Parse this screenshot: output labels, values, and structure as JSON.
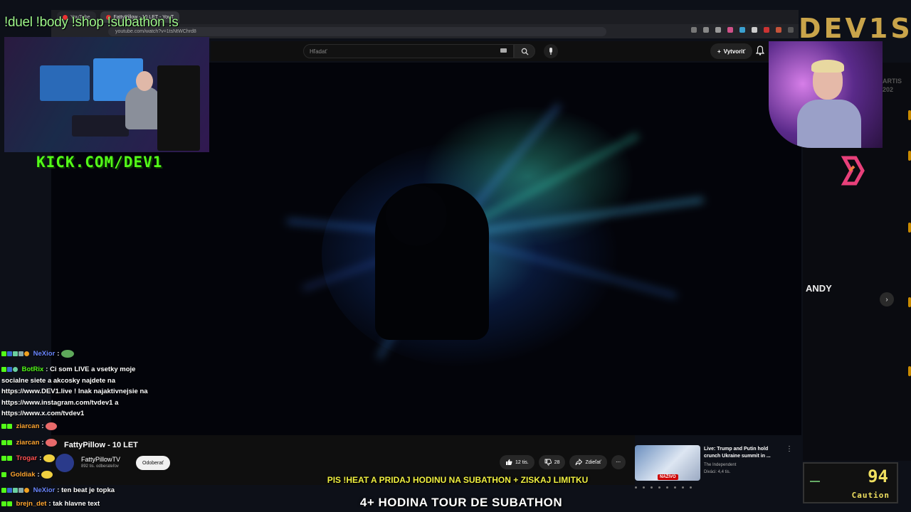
{
  "browser": {
    "tabs": [
      {
        "label": "YouTube",
        "active": false
      },
      {
        "label": "FattyPillow - 10 LET - YouT",
        "active": true
      }
    ],
    "url": "youtube.com/watch?v=1tsNtWChrd8"
  },
  "youtube": {
    "search_placeholder": "Hľadať",
    "create_label": "Vytvoriť",
    "video_title": "FattyPillow - 10 LET",
    "channel_name": "FattyPillowTV",
    "subscribers": "892 tis. odberateľov",
    "subscribe_label": "Odoberať",
    "likes": "12 tis.",
    "dislikes": "28",
    "share_label": "Zdieľať",
    "recommended": {
      "title": "Live: Trump and Putin hold crunch Ukraine summit in ...",
      "channel": "The Independent",
      "viewers": "Diváci: 4,4 tis.",
      "live_badge": "NAŽIVO"
    },
    "side_label": "ANDY",
    "side_label2": "ARTIS\n202"
  },
  "overlay": {
    "commands": "!duel !body !shop !subathon !s",
    "kick_url": "KICK.COM/DEV1",
    "brand": "DEV1S",
    "banner_top": "PIS !HEAT A PRIDAJ HODINU NA SUBATHON + ZISKAJ LIMITKU",
    "banner_bottom": "4+ HODINA TOUR DE SUBATHON",
    "timer_value": "94",
    "timer_label": "Caution"
  },
  "chat": {
    "messages": [
      {
        "user": "NeXior",
        "color": "#6a86ff",
        "text": ":",
        "emote": "#5ea85a"
      },
      {
        "user": "BotRix",
        "color": "#53fc18",
        "text": ": Ci som LIVE a vsetky moje socialne siete a akcosky najdete na https://www.DEV1.live ! Inak najaktivnejsie na https://www.instagram.com/tvdev1 a https://www.x.com/tvdev1"
      },
      {
        "user": "ziarcan",
        "color": "#ffa530",
        "text": ":",
        "emote": "#e86a6a"
      },
      {
        "user": "ziarcan",
        "color": "#ffa530",
        "text": ":",
        "emote": "#e86a6a"
      },
      {
        "user": "Trogar",
        "color": "#ff5050",
        "text": ":",
        "emote": "#f0d040"
      },
      {
        "user": "Goldiak",
        "color": "#ffa530",
        "text": ":",
        "emote": "#f0d040"
      },
      {
        "user": "NeXior",
        "color": "#6a86ff",
        "text": ": ten beat je topka"
      },
      {
        "user": "brejn_det",
        "color": "#ffa530",
        "text": ": tak hlavne text"
      }
    ]
  },
  "colors": {
    "accent_green": "#53fc18",
    "banner_yellow": "#f0f040",
    "yt_red": "#cc0000"
  }
}
